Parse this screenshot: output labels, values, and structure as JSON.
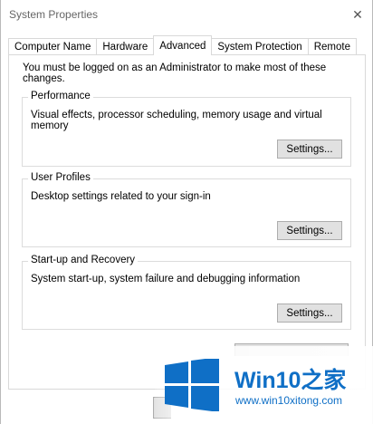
{
  "window": {
    "title": "System Properties",
    "close_glyph": "✕"
  },
  "tabs": [
    {
      "label": "Computer Name",
      "active": false
    },
    {
      "label": "Hardware",
      "active": false
    },
    {
      "label": "Advanced",
      "active": true
    },
    {
      "label": "System Protection",
      "active": false
    },
    {
      "label": "Remote",
      "active": false
    }
  ],
  "advanced": {
    "admin_note": "You must be logged on as an Administrator to make most of these changes.",
    "performance": {
      "title": "Performance",
      "description": "Visual effects, processor scheduling, memory usage and virtual memory",
      "button": "Settings..."
    },
    "user_profiles": {
      "title": "User Profiles",
      "description": "Desktop settings related to your sign-in",
      "button": "Settings..."
    },
    "startup_recovery": {
      "title": "Start-up and Recovery",
      "description": "System start-up, system failure and debugging information",
      "button": "Settings..."
    }
  },
  "watermark": {
    "logo": "windows-logo-icon",
    "title": "Win10之家",
    "url": "www.win10xitong.com",
    "color": "#0f6fc6"
  }
}
